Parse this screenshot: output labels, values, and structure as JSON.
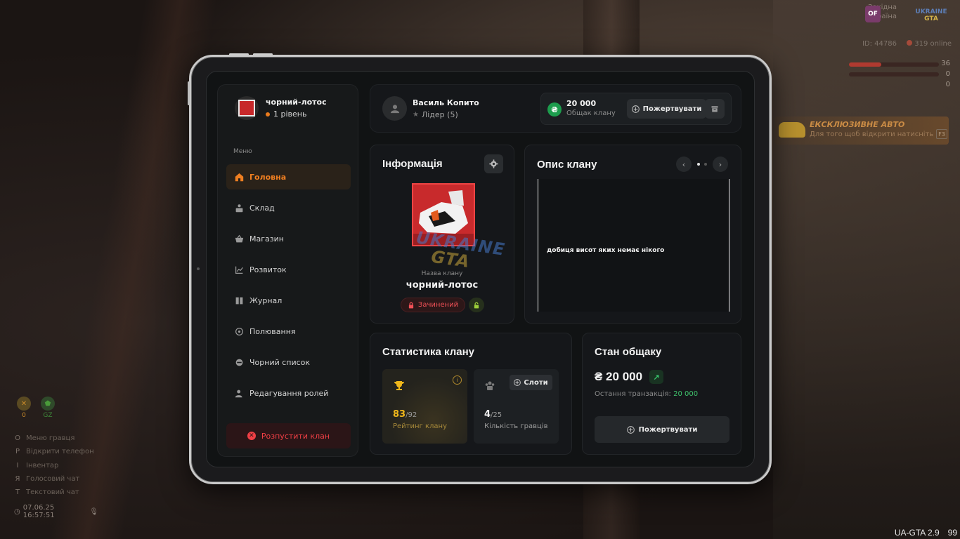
{
  "hud": {
    "server_line1": "Західна",
    "server_line2": "україна",
    "server_badge": "OF",
    "logo_line1": "UKRAINE",
    "logo_line2": "GTA",
    "player_id": "ID: 44786",
    "online": "319 online",
    "health_value": "36",
    "armor_value": "0",
    "money_value": "0",
    "exclusive_title": "ЕКСКЛЮЗИВНЕ АВТО",
    "exclusive_sub": "Для того щоб відкрити натисніть",
    "exclusive_key": "F3",
    "status_icons": [
      {
        "label": "0",
        "color": "#c98a2a"
      },
      {
        "label": "GZ",
        "color": "#3f8b3a"
      }
    ],
    "keyhints": [
      {
        "key": "O",
        "label": "Меню гравця"
      },
      {
        "key": "P",
        "label": "Відкрити телефон"
      },
      {
        "key": "I",
        "label": "Інвентар"
      },
      {
        "key": "Я",
        "label": "Голосовий чат"
      },
      {
        "key": "T",
        "label": "Текстовий чат"
      }
    ],
    "datetime": "07.06.25 16:57:51",
    "build": "UA-GTA 2.9",
    "fps": "99"
  },
  "sidebar": {
    "clan_name": "чорний-лотос",
    "clan_level": "1 рівень",
    "menu_title": "Меню",
    "items": [
      {
        "label": "Головна",
        "icon": "home-icon",
        "active": true
      },
      {
        "label": "Склад",
        "icon": "warehouse-icon",
        "active": false
      },
      {
        "label": "Магазин",
        "icon": "basket-icon",
        "active": false
      },
      {
        "label": "Розвиток",
        "icon": "chart-icon",
        "active": false
      },
      {
        "label": "Журнал",
        "icon": "journal-icon",
        "active": false
      },
      {
        "label": "Полювання",
        "icon": "target-icon",
        "active": false
      },
      {
        "label": "Чорний список",
        "icon": "block-icon",
        "active": false
      },
      {
        "label": "Редагування ролей",
        "icon": "roles-icon",
        "active": false
      }
    ],
    "disband_label": "Розпустити клан"
  },
  "topbar": {
    "user_name": "Василь Копито",
    "user_role": "Лідер (5)",
    "treasury_amount": "20 000",
    "treasury_label": "Общак клану",
    "donate_label": "Пожертвувати"
  },
  "info": {
    "title": "Інформація",
    "name_caption": "Назва клану",
    "clan_name": "чорний-лотос",
    "status_closed": "Зачинений"
  },
  "description": {
    "title": "Опис клану",
    "text": "добиця висот яких немає нікого"
  },
  "stats": {
    "title": "Статистика клану",
    "rating_value": "83",
    "rating_max": "/92",
    "rating_label": "Рейтинг клану",
    "players_value": "4",
    "players_max": "/25",
    "players_label": "Кількість гравців",
    "slots_label": "Слоти"
  },
  "treasury_state": {
    "title": "Стан общаку",
    "amount": "₴ 20 000",
    "last_tx_label": "Остання транзакція:",
    "last_tx_value": "20 000",
    "donate_label": "Пожертвувати"
  },
  "watermark": {
    "line1": "UKRAINE",
    "line2": "GTA"
  },
  "colors": {
    "accent": "#ef7f21",
    "danger": "#ef3f45",
    "success": "#37c069",
    "gold": "#efb71b"
  }
}
